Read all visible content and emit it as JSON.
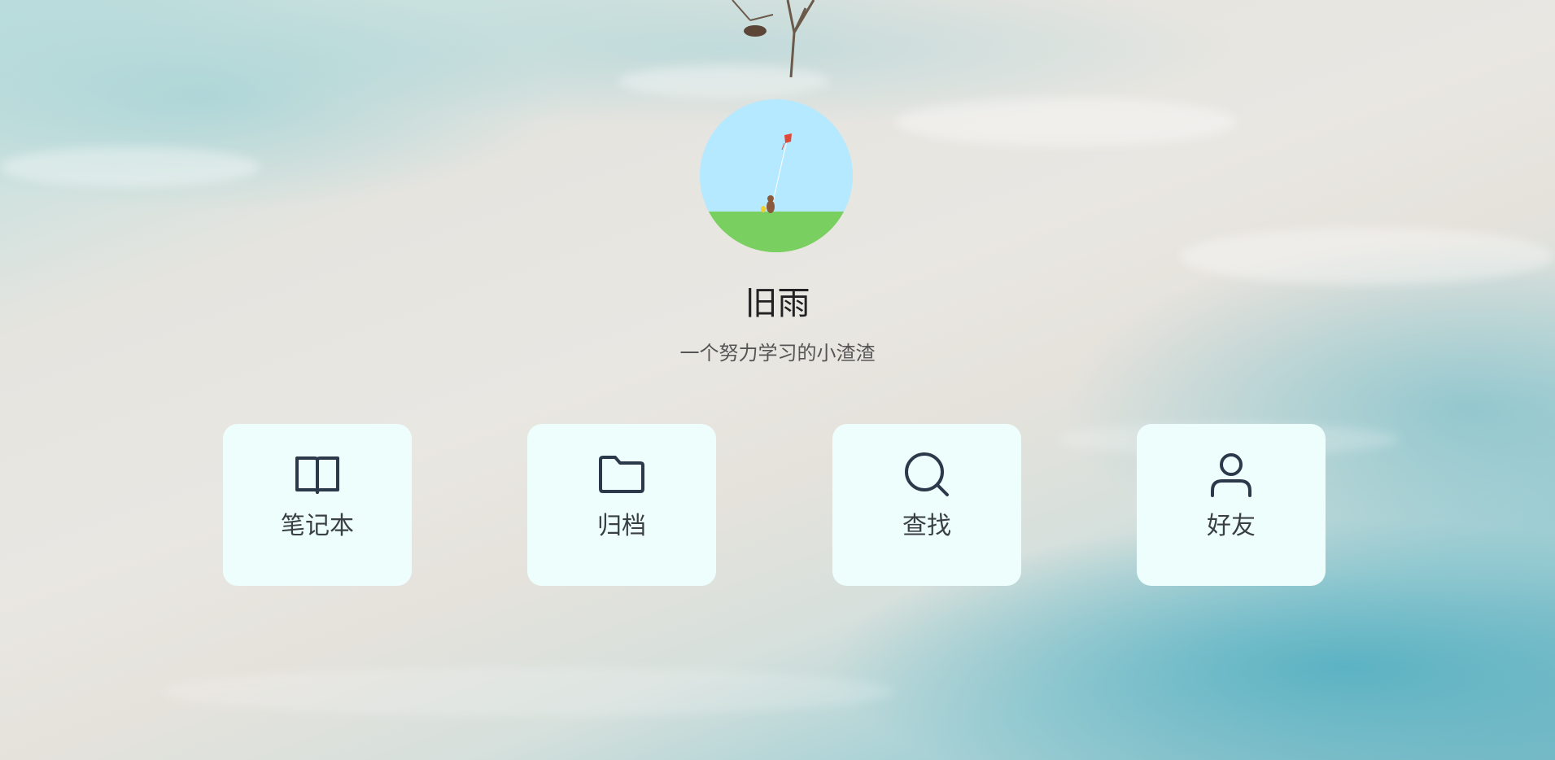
{
  "profile": {
    "name": "旧雨",
    "motto": "一个努力学习的小渣渣"
  },
  "nav": [
    {
      "id": "notebook",
      "label": "笔记本",
      "icon": "book-icon"
    },
    {
      "id": "archive",
      "label": "归档",
      "icon": "folder-icon"
    },
    {
      "id": "search",
      "label": "查找",
      "icon": "search-icon"
    },
    {
      "id": "friends",
      "label": "好友",
      "icon": "user-icon"
    }
  ],
  "colors": {
    "card_background": "#edfefd",
    "icon_stroke": "#2b3a4a",
    "name_text": "#222222",
    "motto_text": "#555555"
  }
}
